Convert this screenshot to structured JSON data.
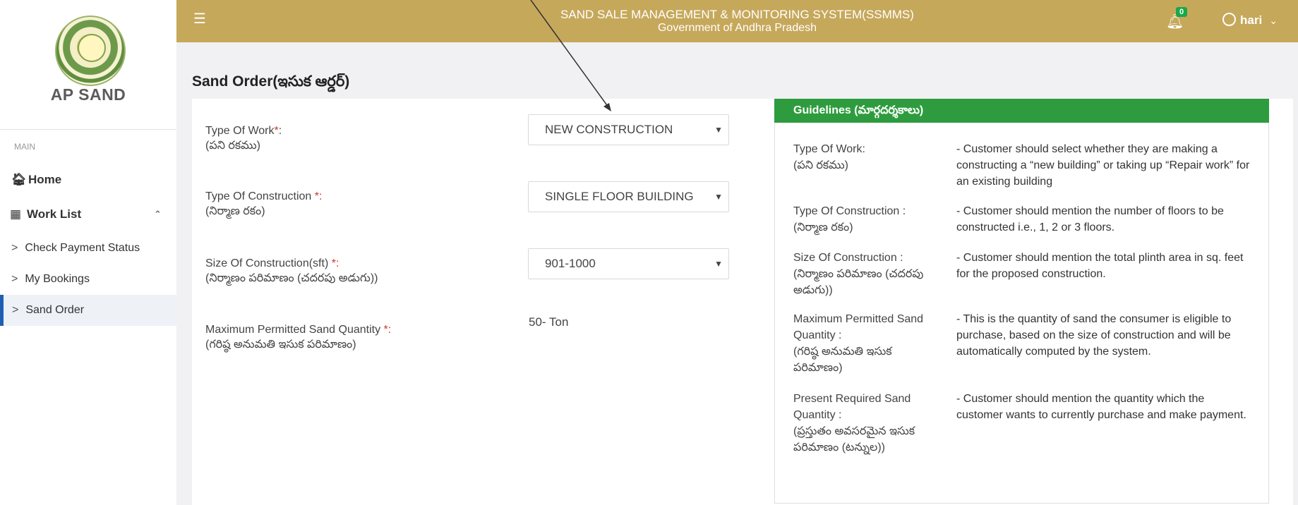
{
  "sidebar": {
    "brand": "AP SAND",
    "section": "MAIN",
    "home": "Home",
    "work_list": "Work List",
    "sub_items": [
      {
        "label": "Check Payment Status"
      },
      {
        "label": "My Bookings"
      },
      {
        "label": "Sand Order"
      }
    ]
  },
  "header": {
    "title_line1": "SAND SALE MANAGEMENT & MONITORING SYSTEM(SSMMS)",
    "title_line2": "Government of Andhra Pradesh",
    "notification_count": "0",
    "user": "hari"
  },
  "page": {
    "title": "Sand Order(ఇసుక ఆర్డర్)"
  },
  "form": {
    "type_of_work": {
      "label": "Type Of Work",
      "label_telugu": "(పని రకము)",
      "value": "NEW CONSTRUCTION"
    },
    "type_of_construction": {
      "label": "Type Of Construction ",
      "label_telugu": "(నిర్మాణ రకం)",
      "value": "SINGLE FLOOR BUILDING"
    },
    "size_of_construction": {
      "label": "Size Of Construction(sft) ",
      "label_telugu": "(నిర్మాణం పరిమాణం (చదరపు అడుగు))",
      "value": "901-1000"
    },
    "max_sand_quantity": {
      "label": "Maximum Permitted Sand Quantity ",
      "label_telugu": "(గరిష్ఠ అనుమతి ఇసుక పరిమాణం)",
      "value": "50- Ton"
    },
    "required_marker": "*",
    "required_marker_colon": "*:"
  },
  "guidelines": {
    "title": "Guidelines (మార్గదర్శకాలు)",
    "items": [
      {
        "term": "Type Of Work:",
        "term_telugu": "(పని రకము)",
        "desc": "- Customer should select whether they are making a constructing a “new building” or taking up “Repair work” for an existing building"
      },
      {
        "term": "Type Of Construction :",
        "term_telugu": "(నిర్మాణ రకం)",
        "desc": "- Customer should mention the number of floors to be constructed i.e., 1, 2 or 3 floors."
      },
      {
        "term": "Size Of Construction :",
        "term_telugu": "(నిర్మాణం పరిమాణం (చదరపు అడుగు))",
        "desc": "- Customer should mention the total plinth area in sq. feet for the proposed construction."
      },
      {
        "term": "Maximum Permitted Sand Quantity :",
        "term_telugu": "(గరిష్ఠ అనుమతి ఇసుక పరిమాణం)",
        "desc": "- This is the quantity of sand the consumer is eligible to purchase, based on the size of construction and will be automatically computed by the system."
      },
      {
        "term": "Present Required Sand Quantity :",
        "term_telugu": "(ప్రస్తుతం అవసరమైన ఇసుక పరిమాణం (టన్నుల))",
        "desc": "- Customer should mention the quantity which the customer wants to currently purchase and make payment."
      }
    ]
  },
  "colors": {
    "header": "#c6a85b",
    "guideline_header": "#2e9c3e",
    "active_nav_border": "#1f5fb5",
    "page_background": "#fcf7e3"
  }
}
